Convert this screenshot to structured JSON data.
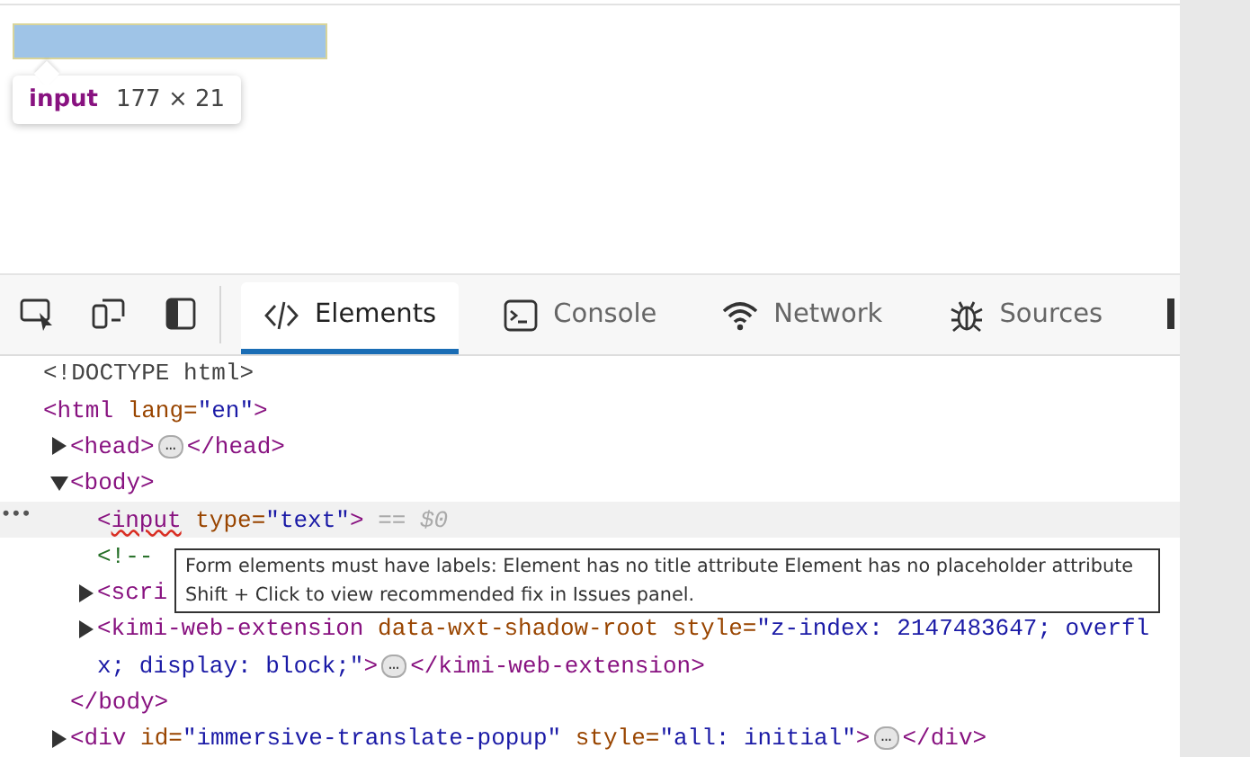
{
  "page": {
    "highlight": {
      "tag": "input",
      "size": "177 × 21"
    }
  },
  "devtools": {
    "tabs": [
      {
        "label": "Elements",
        "selected": true
      },
      {
        "label": "Console",
        "selected": false
      },
      {
        "label": "Network",
        "selected": false
      },
      {
        "label": "Sources",
        "selected": false
      }
    ],
    "dom": [
      {
        "selected": false,
        "lines": [
          [
            {
              "text": "<!DOCTYPE html>",
              "kind": "doctype"
            }
          ]
        ]
      },
      {
        "selected": false,
        "lines": [
          [
            {
              "text": "<html",
              "kind": "tag"
            },
            {
              "text": " lang=",
              "kind": "attr"
            },
            {
              "text": "\"en\"",
              "kind": "value"
            },
            {
              "text": ">",
              "kind": "tag"
            }
          ]
        ],
        "children": [
          {
            "selected": false,
            "expanded": false,
            "lines": [
              [
                {
                  "text": "<head>",
                  "kind": "tag"
                },
                {
                  "text": "…",
                  "kind": "badge"
                },
                {
                  "text": "</head>",
                  "kind": "tag"
                }
              ]
            ]
          },
          {
            "selected": false,
            "expanded": true,
            "lines": [
              [
                {
                  "text": "<body>",
                  "kind": "tag"
                }
              ]
            ],
            "closing": [
              {
                "text": "</body>",
                "kind": "tag"
              }
            ],
            "children": [
              {
                "selected": true,
                "lines": [
                  [
                    {
                      "text": "<",
                      "kind": "tag"
                    },
                    {
                      "text": "input",
                      "kind": "tag-error"
                    },
                    {
                      "text": " type=",
                      "kind": "attr"
                    },
                    {
                      "text": "\"text\"",
                      "kind": "value"
                    },
                    {
                      "text": ">",
                      "kind": "tag"
                    },
                    {
                      "text": " == $0",
                      "kind": "ref"
                    }
                  ]
                ]
              },
              {
                "selected": false,
                "lines": [
                  [
                    {
                      "text": "<!--",
                      "kind": "comment"
                    }
                  ]
                ]
              },
              {
                "selected": false,
                "expanded": false,
                "lines": [
                  [
                    {
                      "text": "<scri",
                      "kind": "tag"
                    }
                  ]
                ]
              },
              {
                "selected": false,
                "expanded": false,
                "lines": [
                  [
                    {
                      "text": "<kimi-web-extension",
                      "kind": "tag"
                    },
                    {
                      "text": " data-wxt-shadow-root style=",
                      "kind": "attr"
                    },
                    {
                      "text": "\"z-index: 2147483647; overfl",
                      "kind": "value"
                    }
                  ],
                  [
                    {
                      "text": "x; display: block;\"",
                      "kind": "value"
                    },
                    {
                      "text": ">",
                      "kind": "tag"
                    },
                    {
                      "text": "…",
                      "kind": "badge"
                    },
                    {
                      "text": "</kimi-web-extension>",
                      "kind": "tag"
                    }
                  ]
                ]
              }
            ]
          },
          {
            "selected": false,
            "expanded": false,
            "lines": [
              [
                {
                  "text": "<div",
                  "kind": "tag"
                },
                {
                  "text": " id=",
                  "kind": "attr"
                },
                {
                  "text": "\"immersive-translate-popup\"",
                  "kind": "value"
                },
                {
                  "text": " style=",
                  "kind": "attr"
                },
                {
                  "text": "\"all: initial\"",
                  "kind": "value"
                },
                {
                  "text": ">",
                  "kind": "tag"
                },
                {
                  "text": "…",
                  "kind": "badge"
                },
                {
                  "text": "</div>",
                  "kind": "tag"
                }
              ]
            ]
          }
        ]
      }
    ],
    "selected_marker": "•••",
    "issue_tooltip": {
      "lines": [
        "Form elements must have labels: Element has no title attribute Element has no placeholder attribute",
        "Shift + Click to view recommended fix in Issues panel."
      ]
    }
  }
}
